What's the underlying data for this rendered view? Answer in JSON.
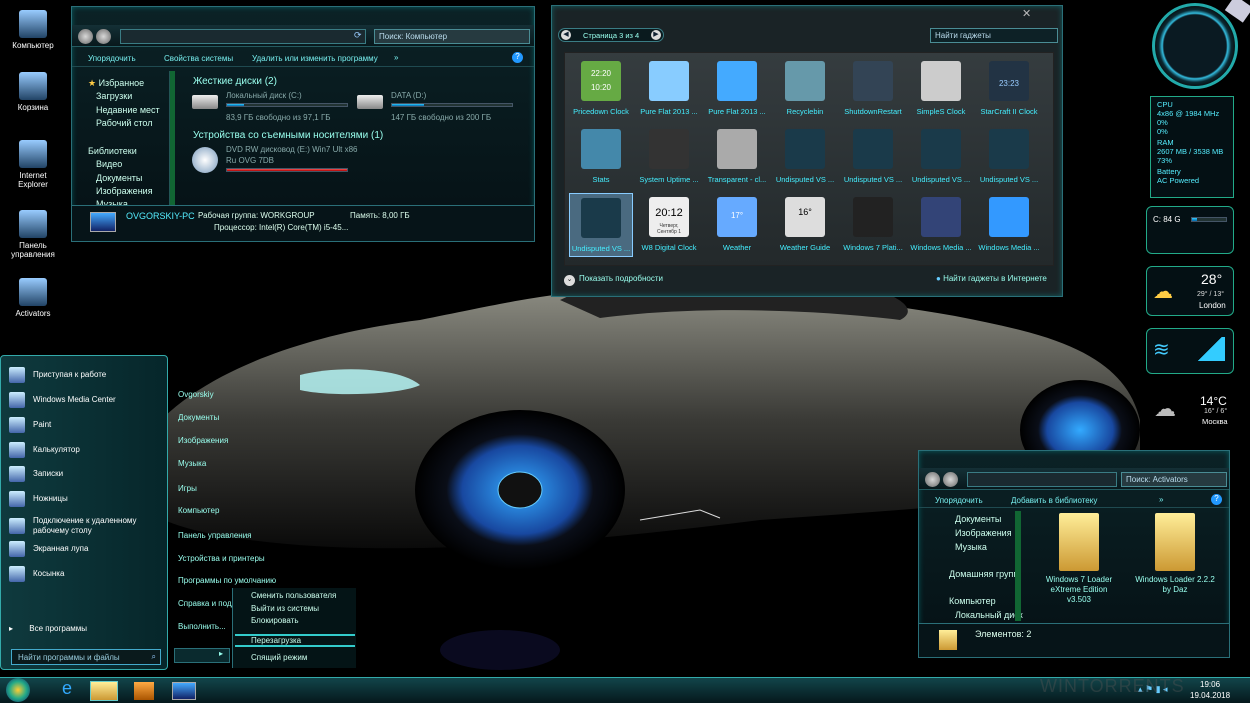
{
  "desktop": {
    "icons": [
      {
        "label": "Компьютер",
        "icon": "computer-icon"
      },
      {
        "label": "Корзина",
        "icon": "recycle-bin-icon"
      },
      {
        "label": "Internet Explorer",
        "icon": "ie-icon"
      },
      {
        "label": "Панель управления",
        "icon": "control-panel-icon"
      },
      {
        "label": "Activators",
        "icon": "activators-icon"
      }
    ]
  },
  "explorer1": {
    "search_placeholder": "Поиск: Компьютер",
    "toolbar": {
      "organize": "Упорядочить",
      "props": "Свойства системы",
      "uninstall": "Удалить или изменить программу",
      "more": "»"
    },
    "nav": {
      "favorites": "Избранное",
      "downloads": "Загрузки",
      "recent": "Недавние мест",
      "desktop": "Рабочий стол",
      "libraries": "Библиотеки",
      "video": "Видео",
      "documents": "Документы",
      "images": "Изображения",
      "music": "Музыка"
    },
    "hdd_header": "Жесткие диски (2)",
    "drives": [
      {
        "name": "Локальный диск (C:)",
        "free": "83,9 ГБ свободно из 97,1 ГБ",
        "used": 0.14
      },
      {
        "name": "DATA (D:)",
        "free": "147 ГБ свободно из 200 ГБ",
        "used": 0.27
      }
    ],
    "removable_header": "Устройства со съемными носителями (1)",
    "dvd": {
      "line1": "DVD RW дисковод (E:) Win7 Ult x86",
      "line2": "Ru OVG 7DB",
      "used": 1.0
    },
    "details": {
      "pc": "OVGORSKIY-PC",
      "workgroup": "Рабочая группа: WORKGROUP",
      "memory": "Память: 8,00 ГБ",
      "cpu": "Процессор: Intel(R) Core(TM) i5-45..."
    }
  },
  "gadgets": {
    "page": "Страница 3 из 4",
    "search_placeholder": "Найти гаджеты",
    "items": [
      "Pricedown Clock",
      "Pure Flat 2013 ...",
      "Pure Flat 2013 ...",
      "Recyclebin",
      "ShutdownRestart",
      "SimpleS Clock",
      "StarCraft II Clock",
      "Stats",
      "System Uptime ...",
      "Transparent - cl...",
      "Undisputed VS ...",
      "Undisputed VS ...",
      "Undisputed VS ...",
      "Undisputed VS ...",
      "Undisputed VS ...",
      "W8 Digital Clock",
      "Weather",
      "Weather Guide",
      "Windows 7 Plati...",
      "Windows Media ...",
      "Windows Media ..."
    ],
    "clock1": "22:20",
    "clock2": "10:20",
    "clock3": "23:23",
    "w8time": "20:12",
    "w8date": "Четверг, Сентябр 1",
    "wg_temp": "16°",
    "wtemp": "17°",
    "show_details": "Показать подробности",
    "find_online": "Найти гаджеты в Интернете"
  },
  "sidebar": {
    "cpu": {
      "title": "CPU",
      "freq": "4x86 @ 1984 MHz",
      "c1": "0%",
      "c2": "0%"
    },
    "ram": {
      "title": "RAM",
      "usage": "2607 MB / 3538 MB",
      "pct": "73%"
    },
    "battery": {
      "title": "Battery",
      "status": "AC Powered"
    },
    "disk": {
      "label": "C: 84 G",
      "fill": 0.14
    },
    "weather1": {
      "temp": "28°",
      "range": "29° / 13°",
      "city": "London"
    },
    "weather2": {
      "temp": "14°C",
      "range": "16° / 6°",
      "city": "Москва"
    }
  },
  "start_menu": {
    "left": [
      {
        "label": "Приступая к работе",
        "icon": "getting-started-icon"
      },
      {
        "label": "Windows Media Center",
        "icon": "media-center-icon"
      },
      {
        "label": "Paint",
        "icon": "paint-icon"
      },
      {
        "label": "Калькулятор",
        "icon": "calculator-icon"
      },
      {
        "label": "Записки",
        "icon": "sticky-notes-icon"
      },
      {
        "label": "Ножницы",
        "icon": "snipping-tool-icon"
      },
      {
        "label": "Подключение к удаленному рабочему столу",
        "icon": "remote-desktop-icon"
      },
      {
        "label": "Экранная лупа",
        "icon": "magnifier-icon"
      },
      {
        "label": "Косынка",
        "icon": "solitaire-icon"
      }
    ],
    "all_programs": "Все программы",
    "search_placeholder": "Найти программы и файлы",
    "right": [
      "Ovgorskiy",
      "Документы",
      "Изображения",
      "Музыка",
      "Игры",
      "Компьютер",
      "Панель управления",
      "Устройства и принтеры",
      "Программы по умолчанию",
      "Справка и подд",
      "Выполнить..."
    ],
    "shutdown_arrow": "▸",
    "power_menu": [
      "Сменить пользователя",
      "Выйти из системы",
      "Блокировать",
      "Перезагрузка",
      "Спящий режим"
    ]
  },
  "explorer2": {
    "search_placeholder": "Поиск: Activators",
    "toolbar": {
      "organize": "Упорядочить",
      "add_library": "Добавить в библиотеку",
      "more": "»"
    },
    "nav": {
      "documents": "Документы",
      "images": "Изображения",
      "music": "Музыка",
      "homegroup": "Домашняя групп",
      "computer": "Компьютер",
      "local_disk": "Локальный диск"
    },
    "files": [
      {
        "label": "Windows 7 Loader eXtreme Edition v3.503"
      },
      {
        "label": "Windows Loader 2.2.2 by Daz"
      }
    ],
    "status": "Элементов: 2"
  },
  "taskbar": {
    "time": "19:06",
    "date": "19.04.2018",
    "watermark": "WINTORRENTS"
  }
}
